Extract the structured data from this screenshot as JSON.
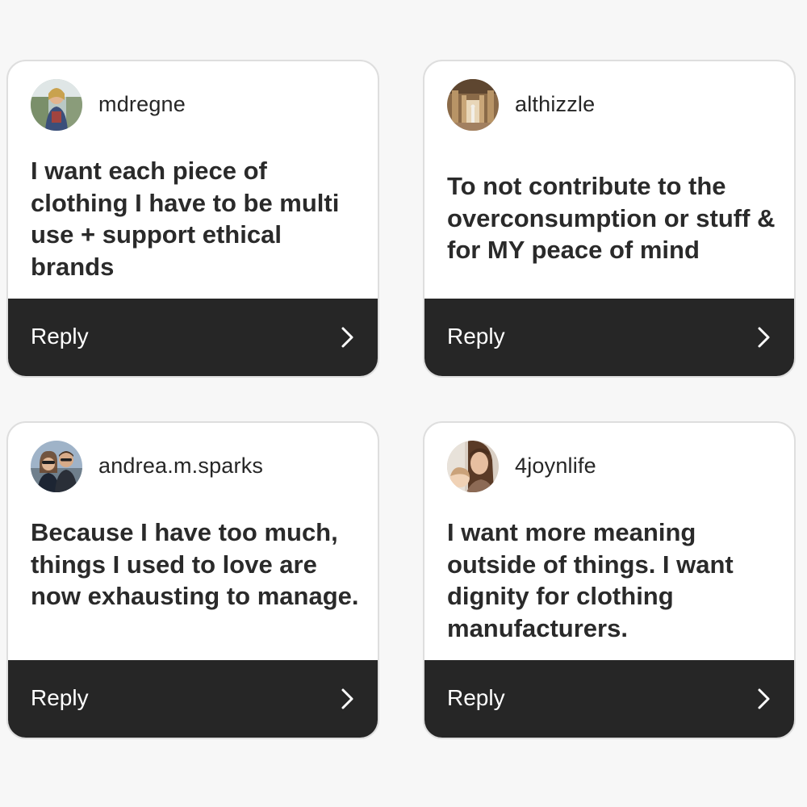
{
  "cards": [
    {
      "username": "mdregne",
      "avatar_icon": "user-avatar-photo",
      "text": "I want each piece of clothing I have to be multi use + support ethical brands",
      "reply_label": "Reply",
      "chevron_icon": "chevron-right-icon"
    },
    {
      "username": "althizzle",
      "avatar_icon": "user-avatar-photo",
      "text": "To not contribute to the overconsumption or stuff & for MY peace of mind",
      "reply_label": "Reply",
      "chevron_icon": "chevron-right-icon"
    },
    {
      "username": "andrea.m.sparks",
      "avatar_icon": "user-avatar-photo",
      "text": "Because I have too much, things I used to love are now exhausting to manage.",
      "reply_label": "Reply",
      "chevron_icon": "chevron-right-icon"
    },
    {
      "username": "4joynlife",
      "avatar_icon": "user-avatar-photo",
      "text": "I want more meaning outside of things. I want dignity for clothing manufacturers.",
      "reply_label": "Reply",
      "chevron_icon": "chevron-right-icon"
    }
  ],
  "colors": {
    "page_background": "#f7f7f7",
    "card_background": "#ffffff",
    "card_border": "#dedede",
    "reply_bar": "#262626",
    "reply_text": "#ffffff",
    "body_text": "#2a2a2a"
  }
}
